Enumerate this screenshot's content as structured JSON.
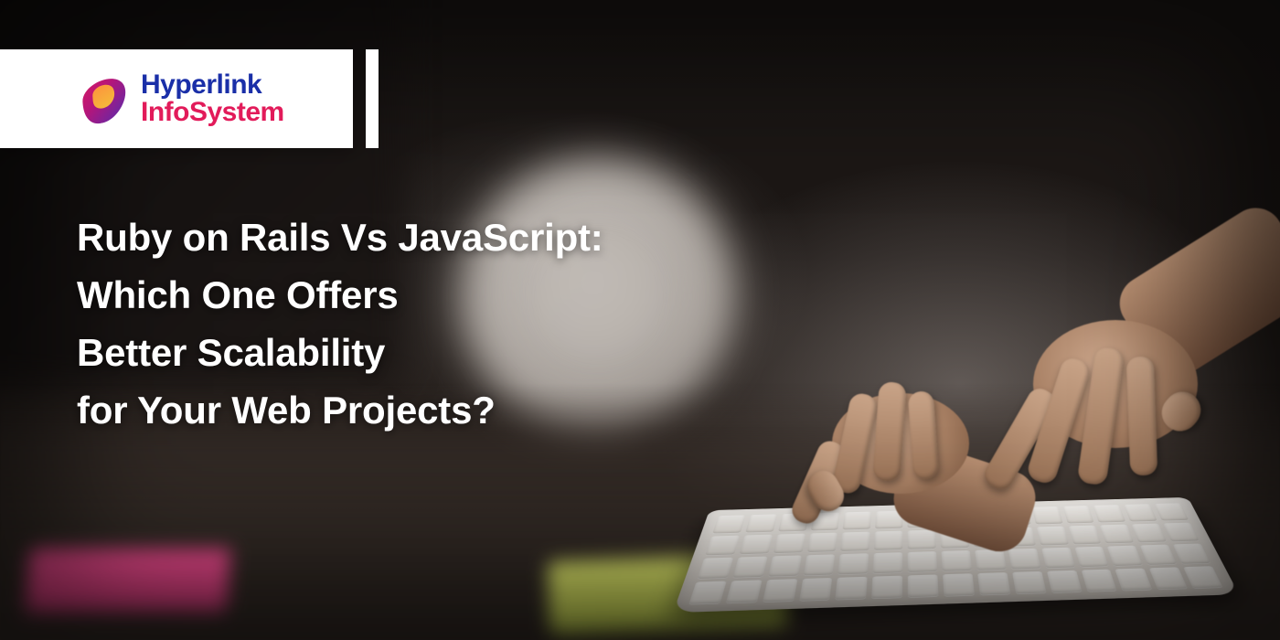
{
  "logo": {
    "line1": "Hyperlink",
    "line2": "InfoSystem"
  },
  "headline": {
    "line1": "Ruby on Rails Vs JavaScript:",
    "line2": "Which One Offers",
    "line3": "Better Scalability",
    "line4": "for Your Web Projects?"
  },
  "colors": {
    "brand_blue": "#1a2fa8",
    "brand_pink": "#e21b5a",
    "text_white": "#ffffff"
  }
}
